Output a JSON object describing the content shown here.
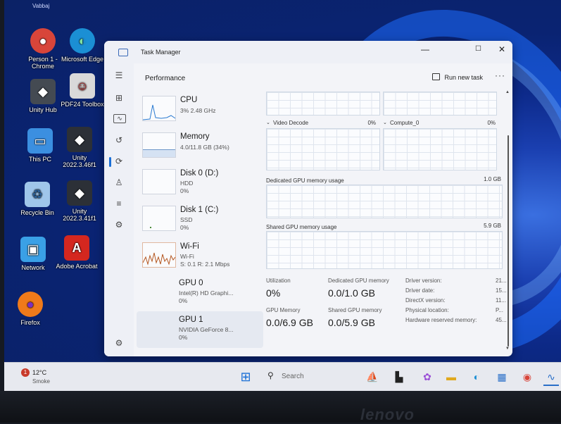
{
  "desktop": {
    "top_label": "Vabbaj",
    "icons": [
      {
        "label": "Person 1 - Chrome",
        "glyph": "●",
        "color": "#d8453a"
      },
      {
        "label": "Microsoft Edge",
        "glyph": "◐",
        "color": "#1b8fd4"
      },
      {
        "label": "Unity Hub",
        "glyph": "◆",
        "color": "#444a52"
      },
      {
        "label": "PDF24 Toolbox",
        "glyph": "☺",
        "color": "#d9d9d9"
      },
      {
        "label": "This PC",
        "glyph": "▭",
        "color": "#3b8fe0"
      },
      {
        "label": "Unity 2022.3.46f1",
        "glyph": "◆",
        "color": "#2c3037"
      },
      {
        "label": "Recycle Bin",
        "glyph": "♻",
        "color": "#9fc6ea"
      },
      {
        "label": "Unity 2022.3.41f1",
        "glyph": "◆",
        "color": "#2c3037"
      },
      {
        "label": "Network",
        "glyph": "▣",
        "color": "#3aa0e6"
      },
      {
        "label": "Adobe Acrobat",
        "glyph": "A",
        "color": "#d4271f"
      },
      {
        "label": "Firefox",
        "glyph": "●",
        "color": "#ef7a1a"
      }
    ]
  },
  "window": {
    "title": "Task Manager",
    "controls": {
      "minimize": "—",
      "maximize": "☐",
      "close": "✕"
    }
  },
  "header": {
    "title": "Performance",
    "run_new_task": "Run new task",
    "more": "···"
  },
  "nav_icons": [
    "hamburger-icon",
    "processes-icon",
    "performance-icon",
    "app-history-icon",
    "startup-icon",
    "users-icon",
    "details-icon",
    "services-icon",
    "settings-icon"
  ],
  "devices": [
    {
      "name": "CPU",
      "lines": [
        "3% 2.48 GHz"
      ]
    },
    {
      "name": "Memory",
      "lines": [
        "4.0/11.8 GB (34%)"
      ]
    },
    {
      "name": "Disk 0 (D:)",
      "lines": [
        "HDD",
        "0%"
      ]
    },
    {
      "name": "Disk 1 (C:)",
      "lines": [
        "SSD",
        "0%"
      ]
    },
    {
      "name": "Wi-Fi",
      "lines": [
        "Wi-Fi",
        "S: 0.1 R: 2.1 Mbps"
      ]
    },
    {
      "name": "GPU 0",
      "lines": [
        "Intel(R) HD Graphi...",
        "0%"
      ]
    },
    {
      "name": "GPU 1",
      "lines": [
        "NVIDIA GeForce 8...",
        "0%"
      ]
    }
  ],
  "gpu": {
    "video_decode_label": "Video Decode",
    "video_decode_value": "0%",
    "compute_label": "Compute_0",
    "compute_value": "0%",
    "dedicated_chart_label": "Dedicated GPU memory usage",
    "dedicated_chart_max": "1.0 GB",
    "shared_chart_label": "Shared GPU memory usage",
    "shared_chart_max": "5.9 GB",
    "stats": {
      "utilization_label": "Utilization",
      "utilization_value": "0%",
      "dedicated_label": "Dedicated GPU memory",
      "dedicated_value": "0.0/1.0 GB",
      "gpu_memory_label": "GPU Memory",
      "gpu_memory_value": "0.0/6.9 GB",
      "shared_label": "Shared GPU memory",
      "shared_value": "0.0/5.9 GB"
    },
    "props": [
      {
        "k": "Driver version:",
        "v": "21..."
      },
      {
        "k": "Driver date:",
        "v": "15..."
      },
      {
        "k": "DirectX version:",
        "v": "11..."
      },
      {
        "k": "Physical location:",
        "v": "P..."
      },
      {
        "k": "Hardware reserved memory:",
        "v": "45..."
      }
    ]
  },
  "taskbar": {
    "weather_temp": "12°C",
    "weather_desc": "Smoke",
    "weather_badge": "1",
    "search_placeholder": "Search"
  },
  "bezel": {
    "brand": "lenovo"
  }
}
